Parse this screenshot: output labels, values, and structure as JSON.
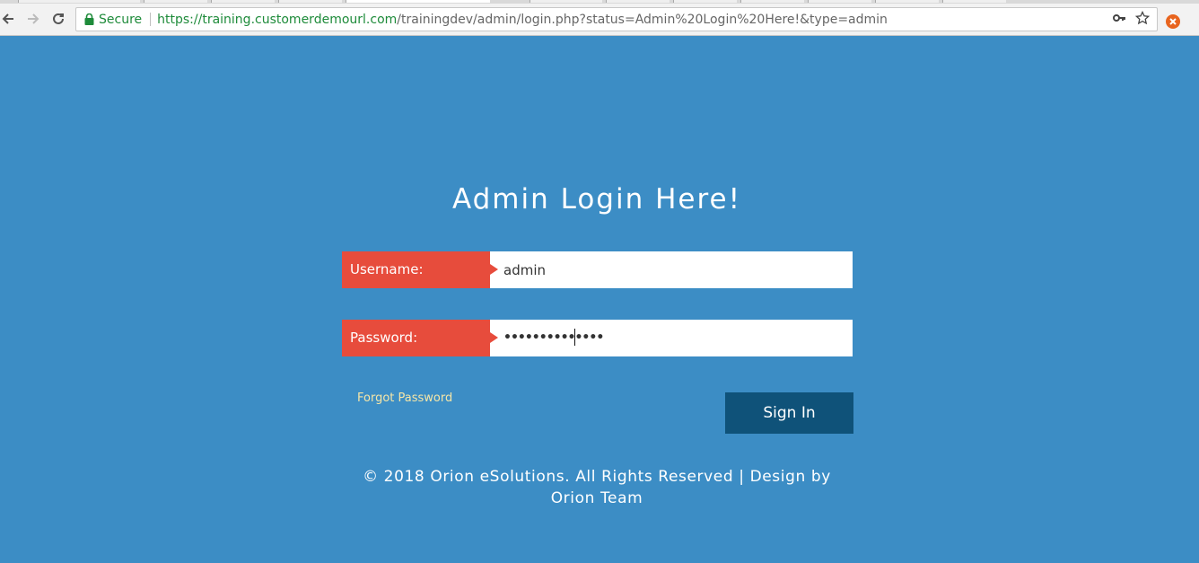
{
  "browser": {
    "secure_label": "Secure",
    "url_scheme": "https://",
    "url_host": "training.customerdemourl.com",
    "url_path": "/trainingdev/admin/login.php?status=Admin%20Login%20Here!&type=admin",
    "icons": [
      "back-arrow-icon",
      "forward-arrow-icon",
      "reload-icon",
      "lock-icon",
      "key-icon",
      "star-icon",
      "extension-icon"
    ]
  },
  "page": {
    "title": "Admin Login Here!",
    "username_label": "Username:",
    "username_value": "admin",
    "password_label": "Password:",
    "password_value": "••••••••••••••",
    "forgot_password": "Forgot Password",
    "sign_in": "Sign In",
    "footer": "© 2018 Orion eSolutions. All Rights Reserved | Design by Orion Team"
  },
  "colors": {
    "background": "#3c8dc5",
    "label_red": "#e74c3c",
    "button_blue": "#0f5279",
    "link_color": "#f5e6a8"
  }
}
